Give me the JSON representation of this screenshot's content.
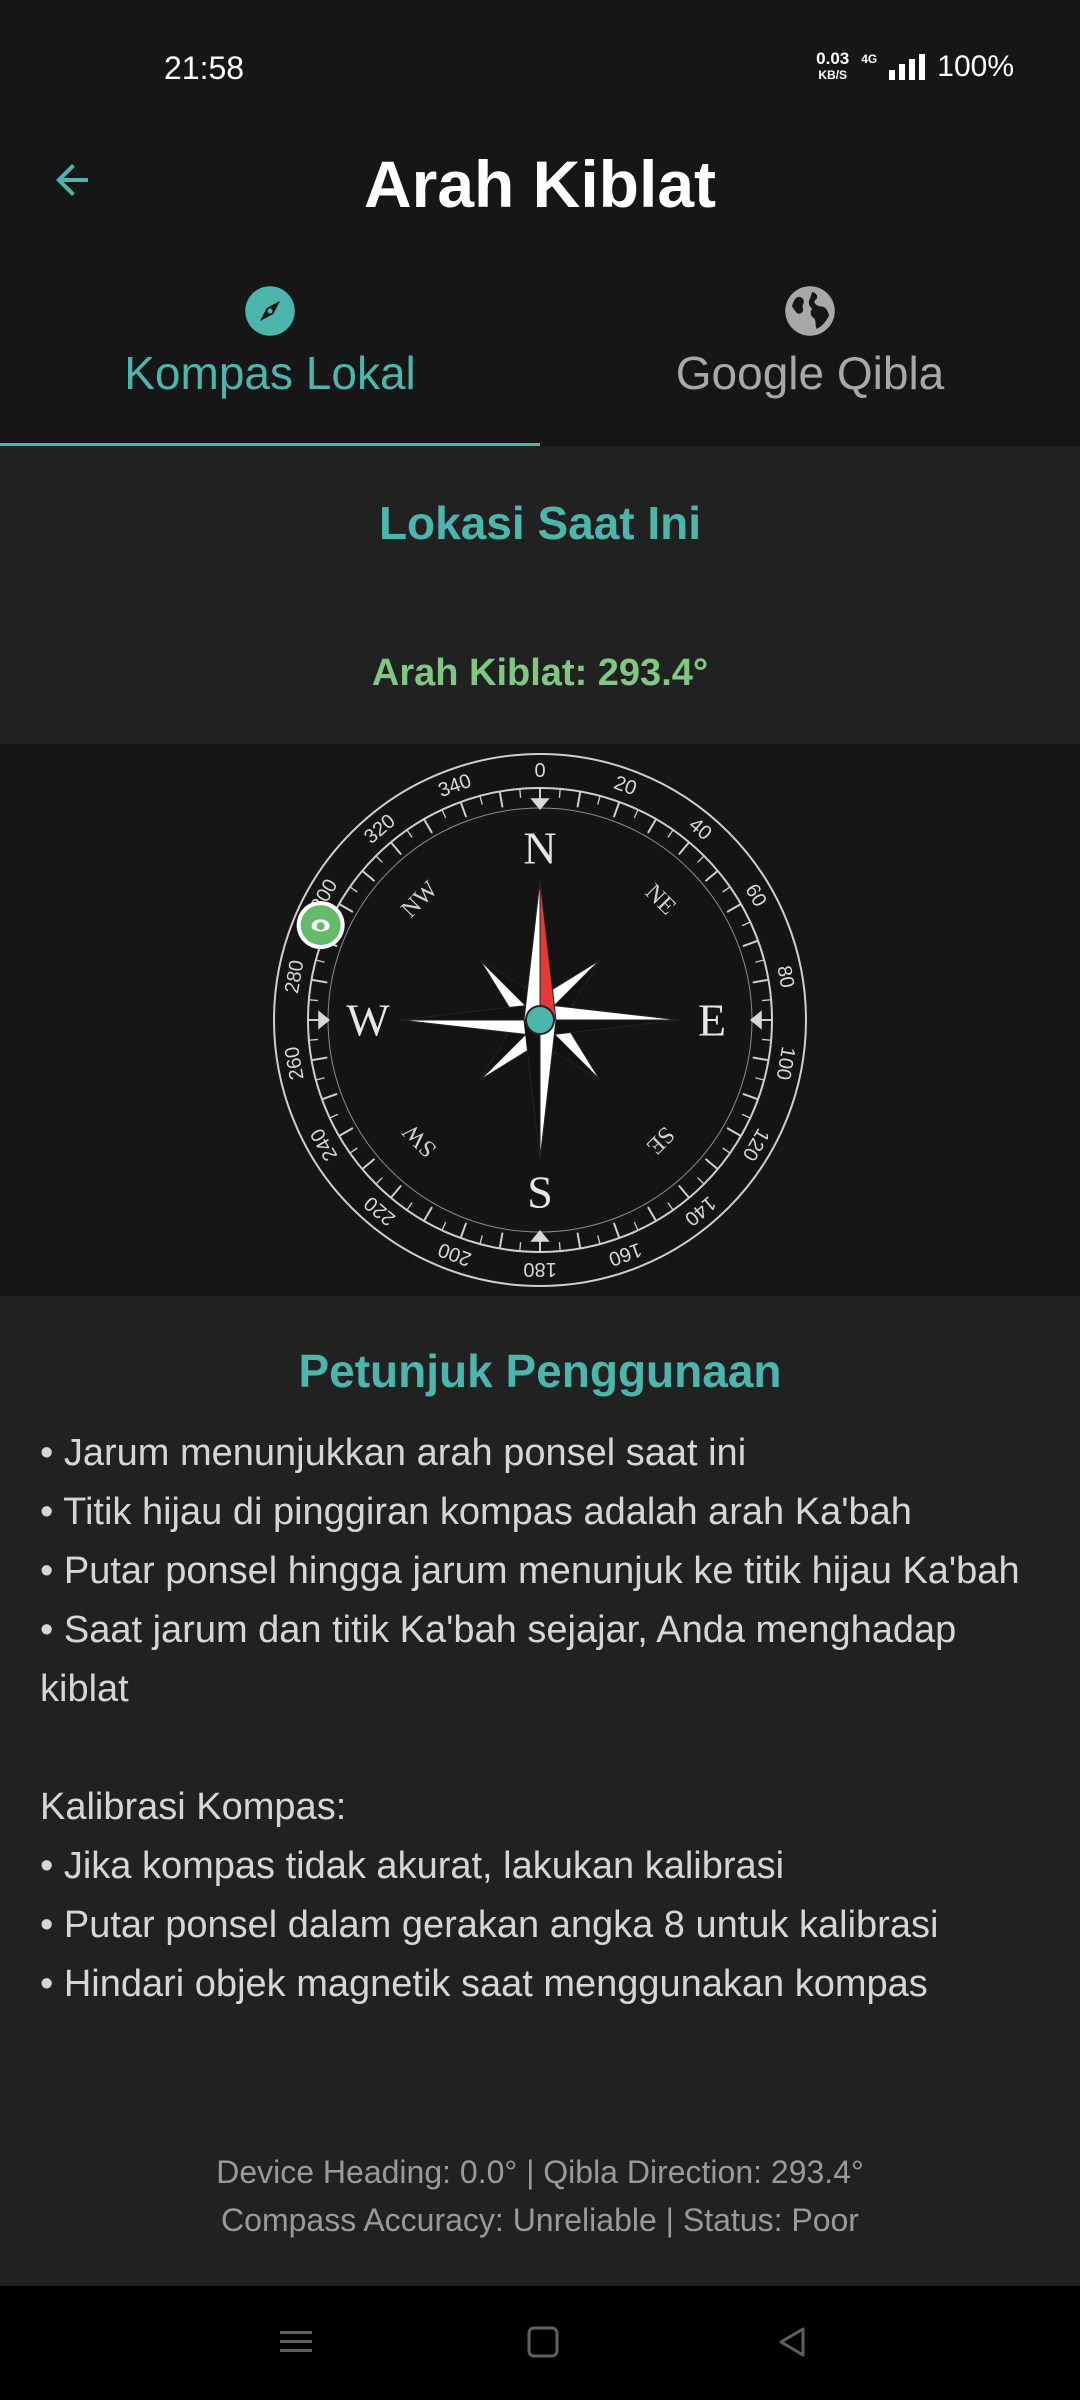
{
  "status_bar": {
    "time": "21:58",
    "speed_value": "0.03",
    "speed_unit": "KB/S",
    "network": "4G",
    "battery": "100%"
  },
  "header": {
    "title": "Arah Kiblat",
    "back_icon": "arrow-left-icon"
  },
  "tabs": [
    {
      "label": "Kompas Lokal",
      "icon": "compass-icon",
      "active": true
    },
    {
      "label": "Google Qibla",
      "icon": "globe-icon",
      "active": false
    }
  ],
  "location": {
    "title": "Lokasi Saat Ini",
    "qibla_direction": "Arah Kiblat: 293.4°"
  },
  "compass": {
    "heading_deg": 0.0,
    "qibla_deg": 293.4,
    "cardinals": {
      "n": "N",
      "e": "E",
      "s": "S",
      "w": "W"
    },
    "intercardinals": {
      "ne": "NE",
      "se": "SE",
      "sw": "SW",
      "nw": "NW"
    },
    "degree_labels": [
      "0",
      "20",
      "40",
      "60",
      "80",
      "100",
      "120",
      "140",
      "160",
      "180",
      "200",
      "220",
      "240",
      "260",
      "280",
      "300",
      "320",
      "340"
    ],
    "accent_color": "#4db6ac",
    "needle_color": "#e53935",
    "qibla_marker_color": "#66bb6a"
  },
  "guide": {
    "title": "Petunjuk Penggunaan",
    "lines": [
      "• Jarum menunjukkan arah ponsel saat ini",
      "• Titik hijau di pinggiran kompas adalah arah Ka'bah",
      "• Putar ponsel hingga jarum menunjuk ke titik hijau Ka'bah",
      "• Saat jarum dan titik Ka'bah sejajar, Anda menghadap kiblat"
    ],
    "calibration_title": "Kalibrasi Kompas:",
    "calibration_lines": [
      "• Jika kompas tidak akurat, lakukan kalibrasi",
      "• Putar ponsel dalam gerakan angka 8 untuk kalibrasi",
      "• Hindari objek magnetik saat menggunakan kompas"
    ]
  },
  "debug": {
    "line1": "Device Heading: 0.0° | Qibla Direction: 293.4°",
    "line2": "Compass Accuracy: Unreliable | Status: Poor"
  },
  "nav_bar": {
    "recents_icon": "menu-icon",
    "home_icon": "square-icon",
    "back_icon": "triangle-back-icon"
  }
}
